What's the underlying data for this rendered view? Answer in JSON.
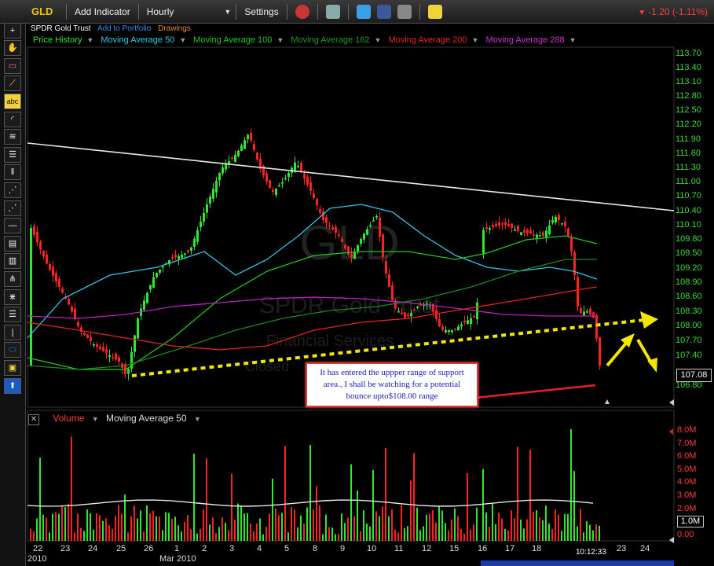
{
  "toolbar": {
    "ticker": "GLD",
    "add_indicator": "Add Indicator",
    "interval": "Hourly",
    "settings": "Settings",
    "change": "-1.20 (-1.11%)"
  },
  "symbol_line": {
    "name": "SPDR Gold Trust",
    "add_to_portfolio": "Add to Portfolio",
    "drawings": "Drawings"
  },
  "legend": {
    "price": "Price History",
    "ma50": "Moving Average 50",
    "ma100": "Moving Average 100",
    "ma162": "Moving Average 162",
    "ma200": "Moving Average 200",
    "ma288": "Moving Average 288"
  },
  "colors": {
    "price_up": "#2ee82e",
    "price_down": "#ff2020",
    "ma50": "#2ec8e8",
    "ma100": "#22c822",
    "ma162": "#1a8a1a",
    "ma200": "#e82222",
    "ma288": "#c020c0",
    "trendline": "#e8e8e8",
    "support": "#f2e600"
  },
  "watermark": {
    "symbol": "GLD",
    "name": "SPDR Gold Trust",
    "sector": "Financial Services",
    "status": "Closed"
  },
  "price_axis": [
    "113.70",
    "113.40",
    "113.10",
    "112.80",
    "112.50",
    "112.20",
    "111.90",
    "111.60",
    "111.30",
    "111.00",
    "110.70",
    "110.40",
    "110.10",
    "109.80",
    "109.50",
    "109.20",
    "108.90",
    "108.60",
    "108.30",
    "108.00",
    "107.70",
    "107.40",
    "107.08",
    "106.80"
  ],
  "last_price": "107.08",
  "volume_panel": {
    "label": "Volume",
    "ma_label": "Moving Average 50",
    "close_icon": "x-icon",
    "axis": [
      "8.0M",
      "7.0M",
      "6.0M",
      "5.0M",
      "4.0M",
      "3.0M",
      "2.0M",
      "1.0M",
      "0.00"
    ],
    "current": "1.0M"
  },
  "x_axis": {
    "days": [
      "22",
      "23",
      "24",
      "25",
      "26",
      "1",
      "2",
      "3",
      "4",
      "5",
      "8",
      "9",
      "10",
      "11",
      "12",
      "15",
      "16",
      "17",
      "18",
      "23",
      "24"
    ],
    "year_label": "2010",
    "month_label": "Mar 2010",
    "timestamp": "10:12:33"
  },
  "annotation": {
    "text": "It has entered the uppper range of support area., I shall be watching for a potential bounce upto$108.00 range"
  },
  "tools": [
    "crosshair-icon",
    "plus-icon",
    "hand-icon",
    "eraser-icon",
    "line-icon",
    "text-tool-icon",
    "arc-icon",
    "fan-icon",
    "fib-icon",
    "channel-icon",
    "cycle-icon",
    "speed-icon",
    "horizontal-line-icon",
    "grid-icon",
    "bars-icon",
    "pitchfork-icon",
    "gann-icon",
    "levels-icon",
    "vertical-line-icon",
    "ellipse-icon",
    "rectangle-icon",
    "arrow-icon"
  ]
}
